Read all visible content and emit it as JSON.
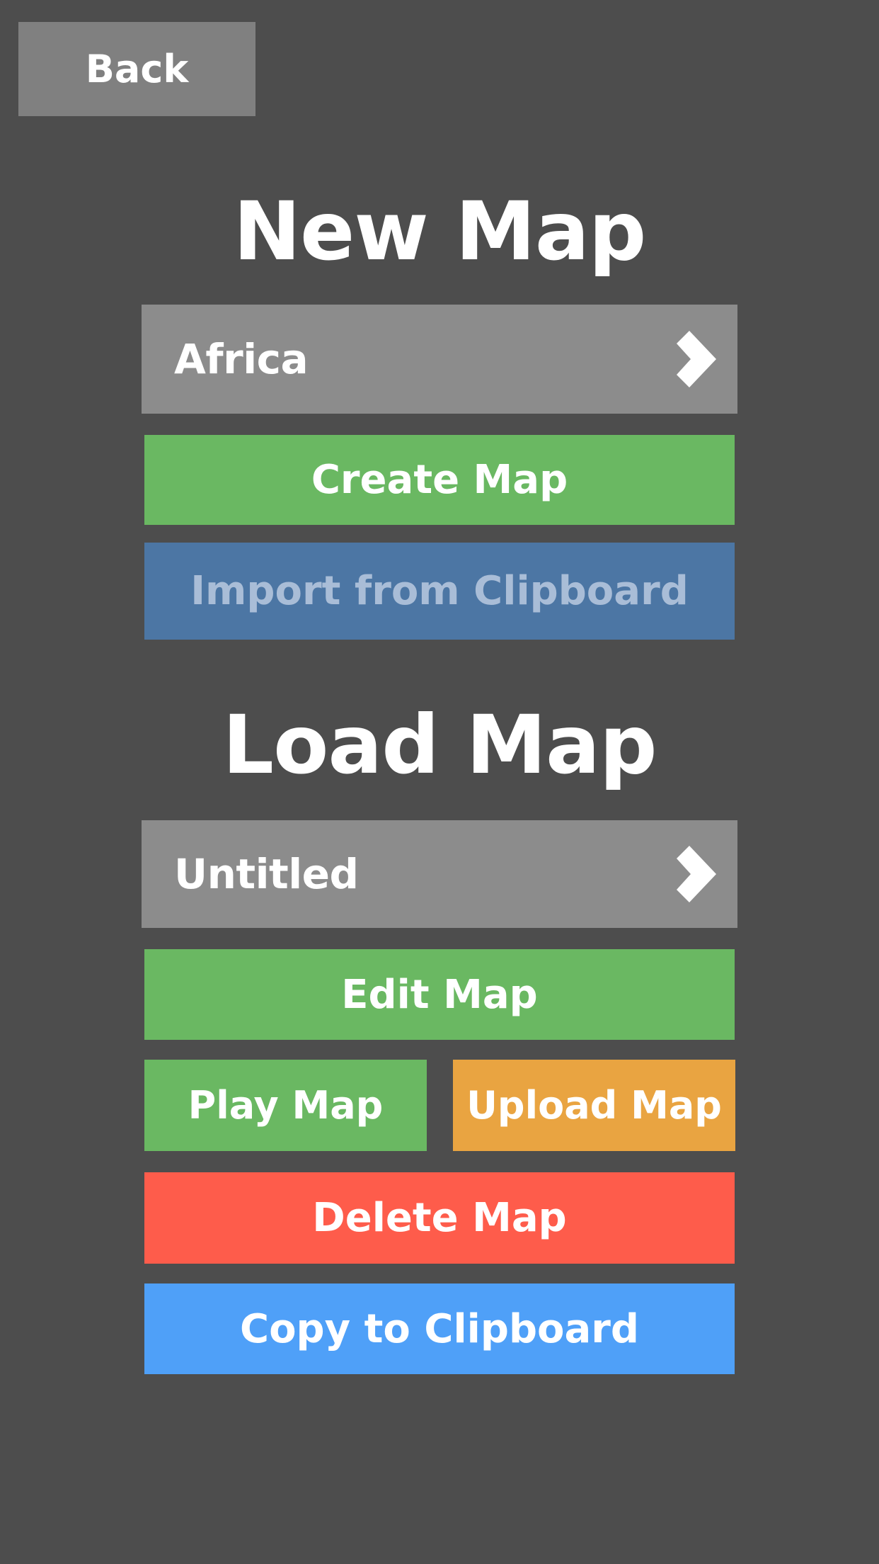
{
  "header": {
    "back_label": "Back"
  },
  "new_map": {
    "title": "New Map",
    "template_selector": {
      "value": "Africa",
      "icon": "chevron-right-icon"
    },
    "create_label": "Create Map",
    "import_label": "Import from Clipboard",
    "import_disabled": true
  },
  "load_map": {
    "title": "Load Map",
    "map_selector": {
      "value": "Untitled",
      "icon": "chevron-right-icon"
    },
    "edit_label": "Edit Map",
    "play_label": "Play Map",
    "upload_label": "Upload Map",
    "delete_label": "Delete Map",
    "copy_label": "Copy to Clipboard"
  },
  "colors": {
    "background": "#4d4d4d",
    "back_button": "#808080",
    "selector": "#8c8c8c",
    "green": "#6ab862",
    "import_disabled": "#4c76a4",
    "orange": "#e9a441",
    "red": "#fe5c4b",
    "blue": "#4fa0f8"
  }
}
